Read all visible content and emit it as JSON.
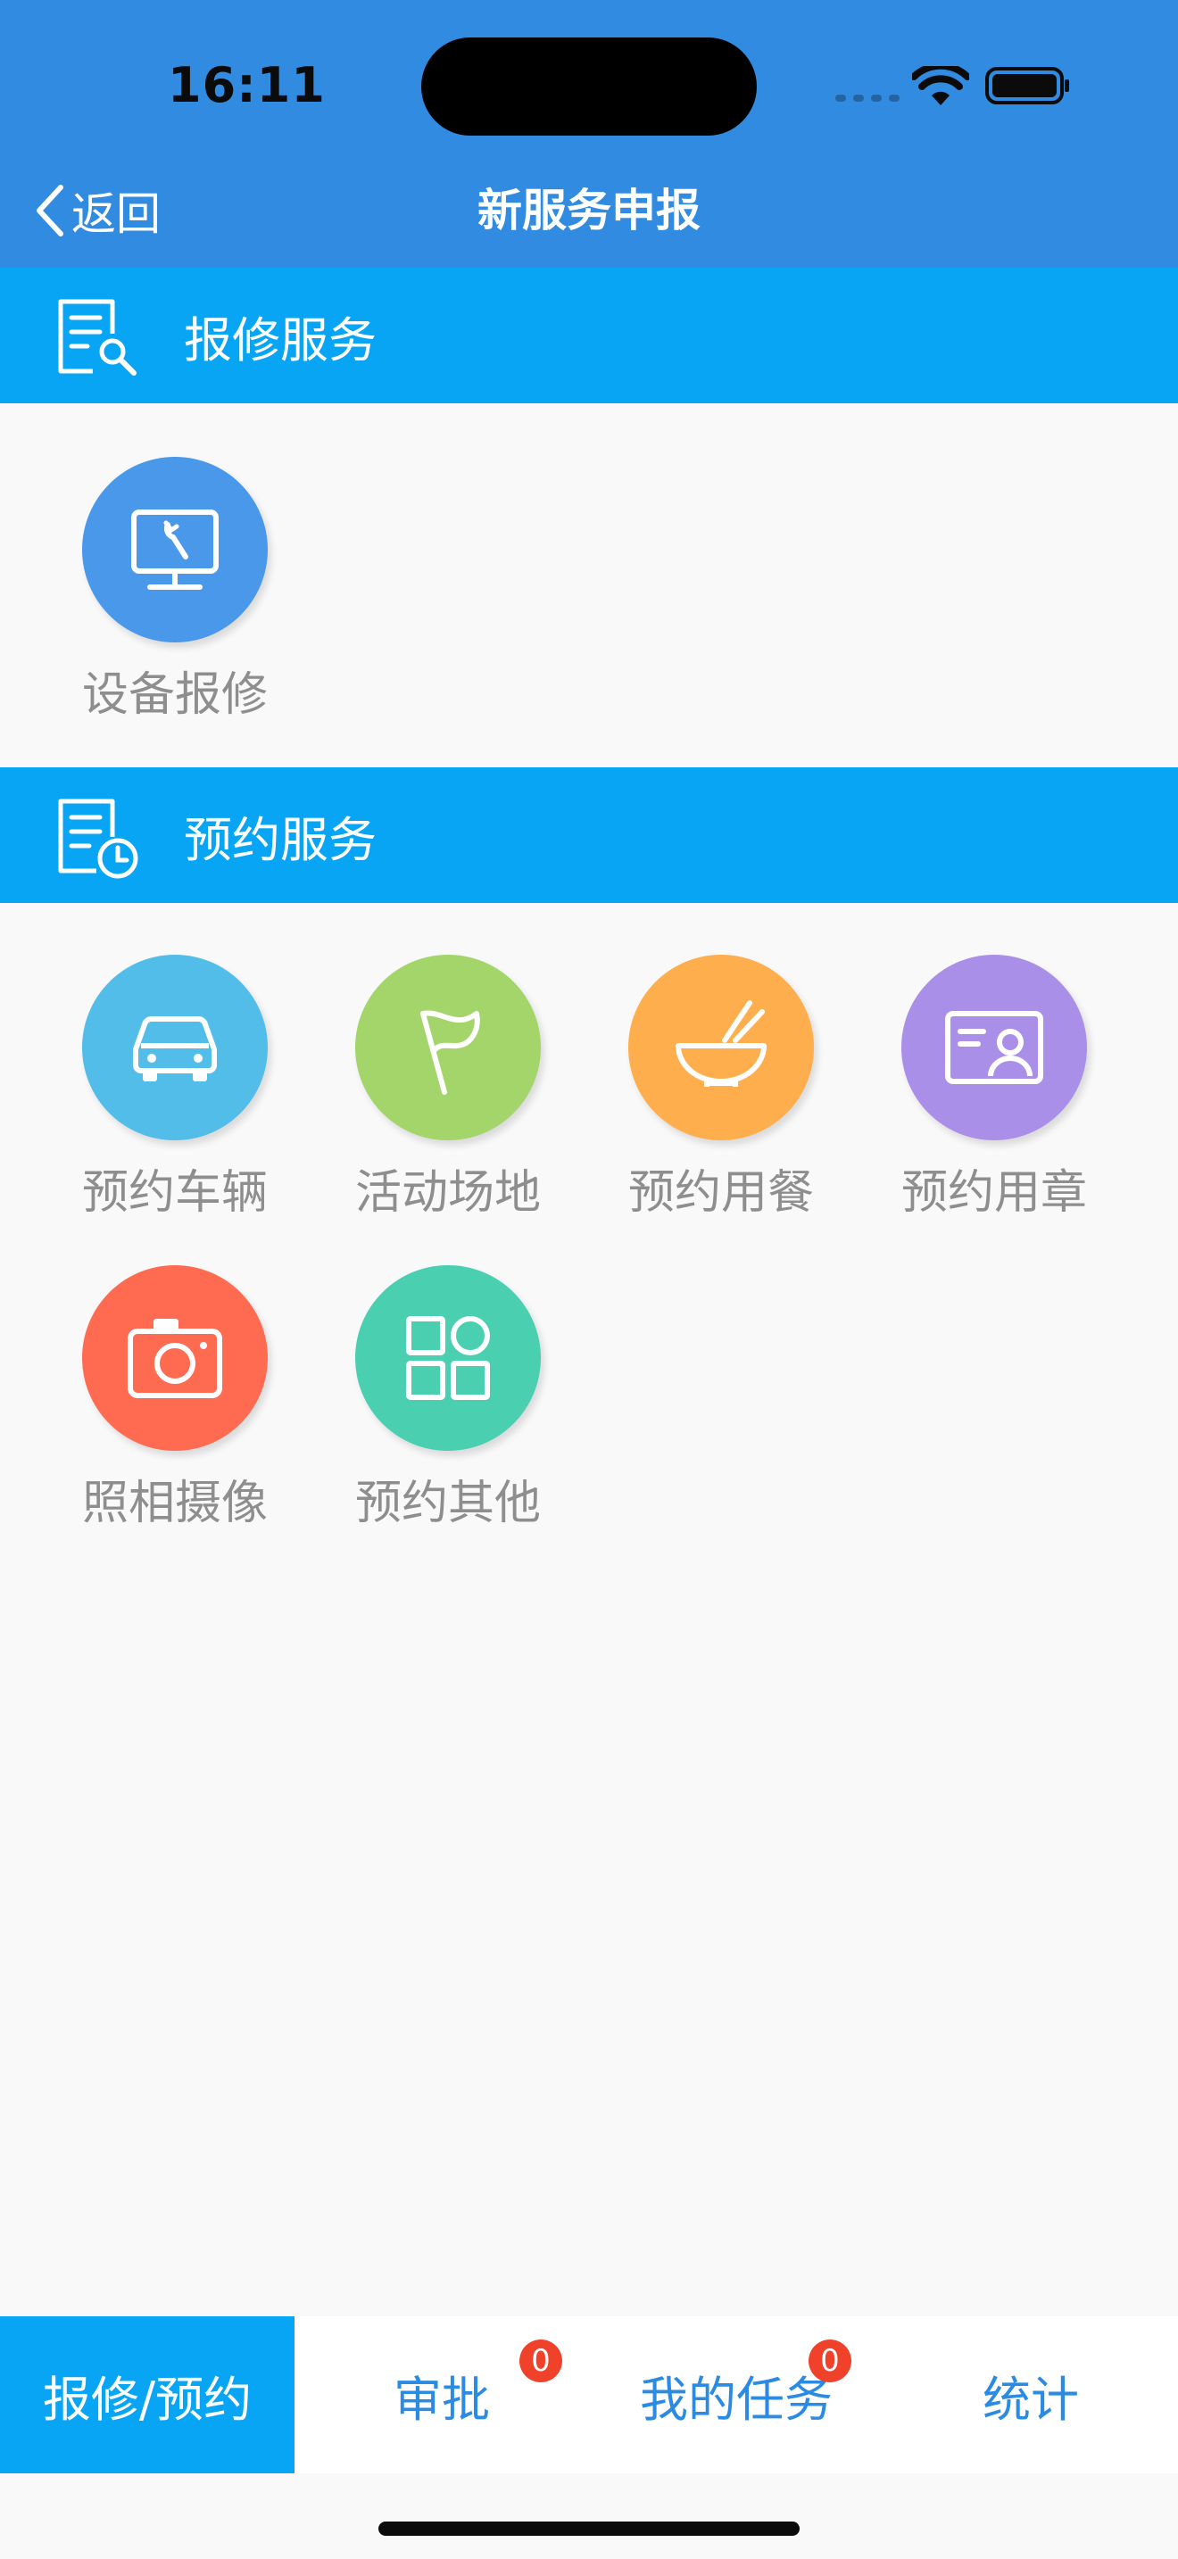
{
  "colors": {
    "nav_bg": "#318be0",
    "section_bg": "#07a5f4",
    "accent": "#2b8ae2",
    "badge": "#f0412b"
  },
  "status_bar": {
    "time": "16:11"
  },
  "nav": {
    "back_label": "返回",
    "title": "新服务申报"
  },
  "sections": [
    {
      "title": "报修服务",
      "icon": "repair-doc-icon",
      "items": [
        {
          "label": "设备报修",
          "icon": "monitor-wrench-icon",
          "color": "#4a98ea"
        }
      ]
    },
    {
      "title": "预约服务",
      "icon": "schedule-doc-icon",
      "items": [
        {
          "label": "预约车辆",
          "icon": "car-icon",
          "color": "#52bde9"
        },
        {
          "label": "活动场地",
          "icon": "flag-icon",
          "color": "#a3d56b"
        },
        {
          "label": "预约用餐",
          "icon": "bowl-icon",
          "color": "#ffae4d"
        },
        {
          "label": "预约用章",
          "icon": "id-card-icon",
          "color": "#a98fe8"
        },
        {
          "label": "照相摄像",
          "icon": "camera-icon",
          "color": "#ff6b51"
        },
        {
          "label": "预约其他",
          "icon": "grid-icon",
          "color": "#4acfb0"
        }
      ]
    }
  ],
  "tabs": [
    {
      "label": "报修/预约",
      "active": true
    },
    {
      "label": "审批",
      "badge": "0"
    },
    {
      "label": "我的任务",
      "badge": "0"
    },
    {
      "label": "统计"
    }
  ]
}
